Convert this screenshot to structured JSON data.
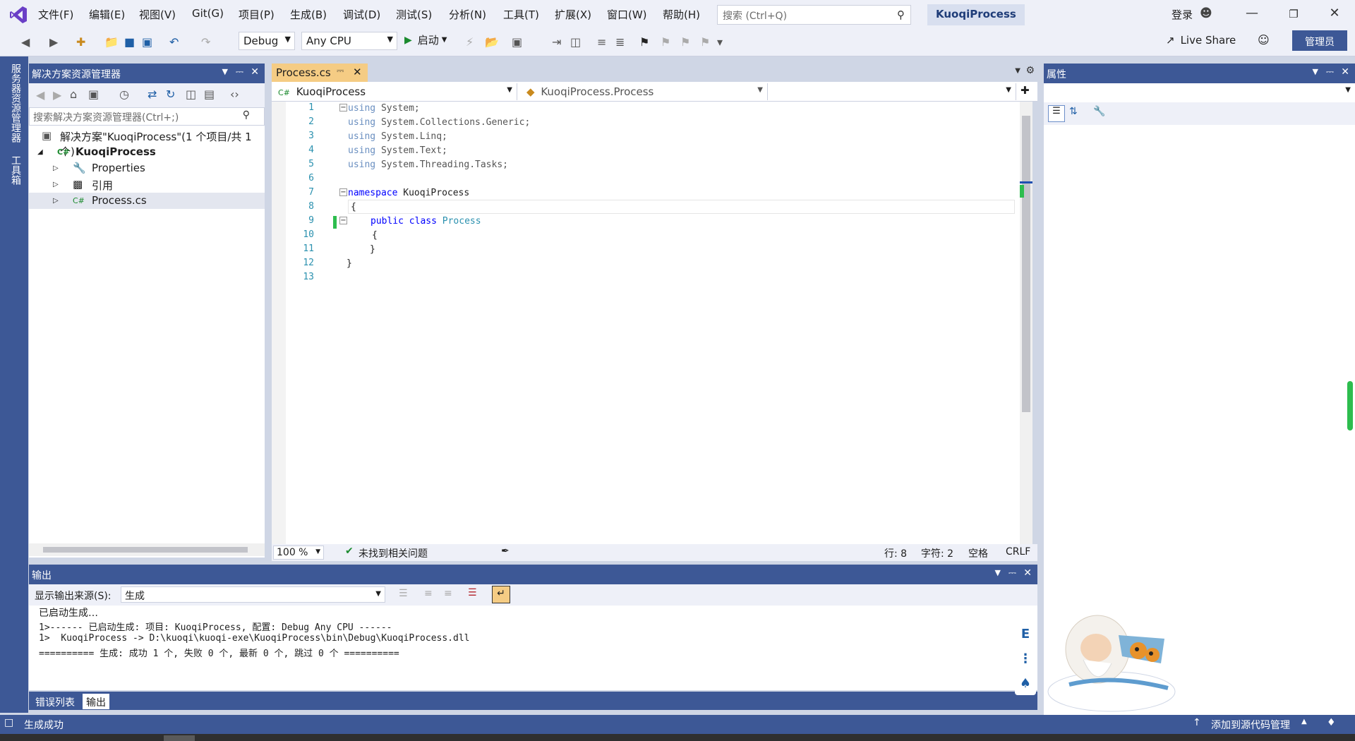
{
  "menu": {
    "items": [
      "文件(F)",
      "编辑(E)",
      "视图(V)",
      "Git(G)",
      "项目(P)",
      "生成(B)",
      "调试(D)",
      "测试(S)",
      "分析(N)",
      "工具(T)",
      "扩展(X)",
      "窗口(W)",
      "帮助(H)"
    ],
    "search_placeholder": "搜索 (Ctrl+Q)",
    "project_title": "KuoqiProcess",
    "login_label": "登录"
  },
  "toolbar": {
    "config": "Debug",
    "platform": "Any CPU",
    "start_label": "启动",
    "liveshare_label": "Live Share",
    "admin_label": "管理员"
  },
  "left_strip": {
    "server_explorer": "服务器资源管理器",
    "toolbox": "工具箱"
  },
  "solution_explorer": {
    "title": "解决方案资源管理器",
    "search_placeholder": "搜索解决方案资源管理器(Ctrl+;)",
    "solution_label": "解决方案\"KuoqiProcess\"(1 个项目/共 1 个)",
    "project_label": "KuoqiProcess",
    "items": [
      "Properties",
      "引用",
      "Process.cs"
    ]
  },
  "editor": {
    "tab_label": "Process.cs",
    "nav_project": "KuoqiProcess",
    "nav_class": "KuoqiProcess.Process",
    "zoom": "100 %",
    "issues_label": "未找到相关问题",
    "line_label": "行: 8",
    "char_label": "字符: 2",
    "space_label": "空格",
    "eol_label": "CRLF",
    "line_numbers": [
      "1",
      "2",
      "3",
      "4",
      "5",
      "6",
      "7",
      "8",
      "9",
      "10",
      "11",
      "12",
      "13"
    ],
    "code": {
      "l1_kw": "using",
      "l1_rest": " System;",
      "l2_kw": "using",
      "l2_rest": " System.Collections.Generic;",
      "l3_kw": "using",
      "l3_rest": " System.Linq;",
      "l4_kw": "using",
      "l4_rest": " System.Text;",
      "l5_kw": "using",
      "l5_rest": " System.Threading.Tasks;",
      "l7_kw": "namespace",
      "l7_rest": " KuoqiProcess",
      "l8": "{",
      "l9_kw1": "public",
      "l9_kw2": "class",
      "l9_type": "Process",
      "l10": "{",
      "l11": "}",
      "l12": "}"
    }
  },
  "properties": {
    "title": "属性"
  },
  "output": {
    "title": "输出",
    "source_label": "显示输出来源(S):",
    "source_value": "生成",
    "lines": [
      "已启动生成…",
      "1>------ 已启动生成: 项目: KuoqiProcess, 配置: Debug Any CPU ------",
      "1>  KuoqiProcess -> D:\\kuoqi\\kuoqi-exe\\KuoqiProcess\\bin\\Debug\\KuoqiProcess.dll",
      "========== 生成: 成功 1 个, 失败 0 个, 最新 0 个, 跳过 0 个 =========="
    ],
    "tabs": [
      "错误列表",
      "输出"
    ]
  },
  "status": {
    "message": "生成成功",
    "source_control": "添加到源代码管理"
  },
  "colors": {
    "accent": "#3d5896",
    "tab_active": "#f5cc84",
    "keyword": "#0000ff",
    "type": "#2b91af"
  }
}
